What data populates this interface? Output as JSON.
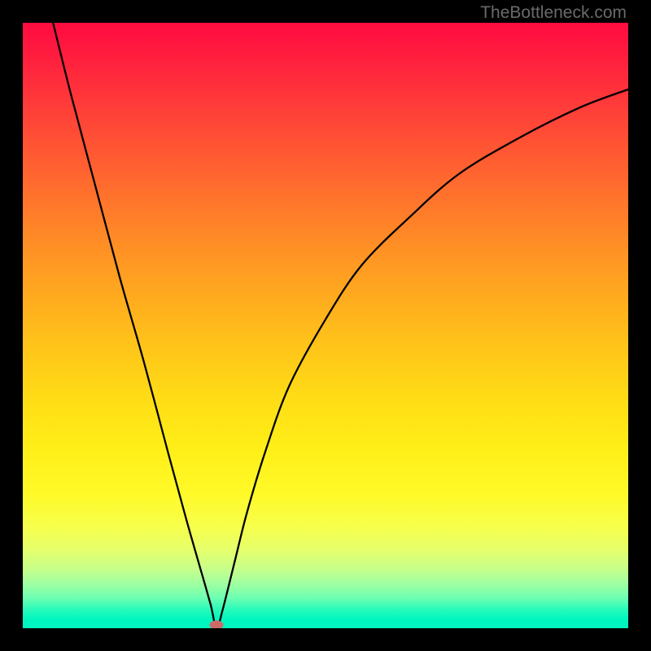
{
  "watermark": "TheBottleneck.com",
  "chart_data": {
    "type": "line",
    "title": "",
    "xlabel": "",
    "ylabel": "",
    "xlim": [
      0,
      100
    ],
    "ylim": [
      0,
      100
    ],
    "grid": false,
    "optimum_x": 32,
    "series": [
      {
        "name": "curve",
        "x": [
          5,
          8,
          12,
          16,
          20,
          24,
          27,
          29,
          31,
          32,
          33,
          35,
          37,
          40,
          44,
          50,
          56,
          64,
          72,
          82,
          92,
          100
        ],
        "values": [
          100,
          88,
          73,
          58,
          44,
          29,
          18,
          11,
          4,
          0,
          3,
          11,
          19,
          29,
          40,
          51,
          60,
          68,
          75,
          81,
          86,
          89
        ]
      }
    ],
    "marker": {
      "x": 32,
      "y": 0,
      "color": "#cf6a6a"
    }
  },
  "colors": {
    "frame": "#000000",
    "gradient_top": "#ff0b41",
    "gradient_bottom": "#00f6c0",
    "curve": "#000000",
    "watermark": "#6a6a6a"
  }
}
